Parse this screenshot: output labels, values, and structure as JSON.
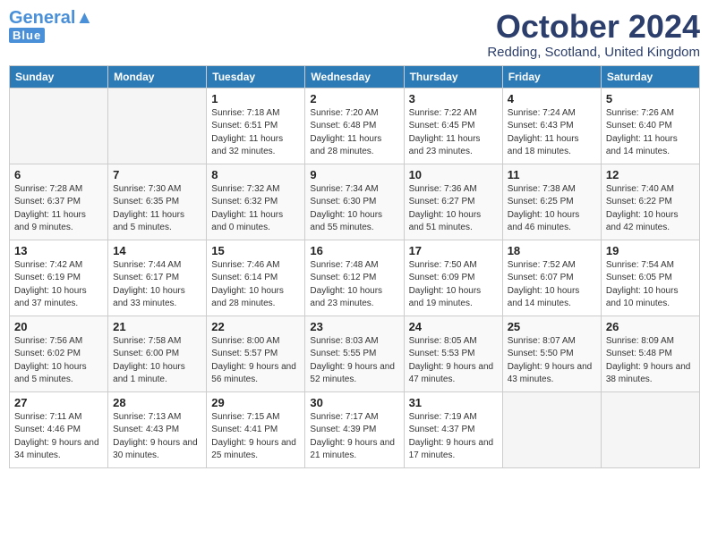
{
  "header": {
    "logo_general": "General",
    "logo_blue": "Blue",
    "title": "October 2024",
    "subtitle": "Redding, Scotland, United Kingdom"
  },
  "days_of_week": [
    "Sunday",
    "Monday",
    "Tuesday",
    "Wednesday",
    "Thursday",
    "Friday",
    "Saturday"
  ],
  "weeks": [
    [
      {
        "day": "",
        "sunrise": "",
        "sunset": "",
        "daylight": "",
        "empty": true
      },
      {
        "day": "",
        "sunrise": "",
        "sunset": "",
        "daylight": "",
        "empty": true
      },
      {
        "day": "1",
        "sunrise": "Sunrise: 7:18 AM",
        "sunset": "Sunset: 6:51 PM",
        "daylight": "Daylight: 11 hours and 32 minutes.",
        "empty": false
      },
      {
        "day": "2",
        "sunrise": "Sunrise: 7:20 AM",
        "sunset": "Sunset: 6:48 PM",
        "daylight": "Daylight: 11 hours and 28 minutes.",
        "empty": false
      },
      {
        "day": "3",
        "sunrise": "Sunrise: 7:22 AM",
        "sunset": "Sunset: 6:45 PM",
        "daylight": "Daylight: 11 hours and 23 minutes.",
        "empty": false
      },
      {
        "day": "4",
        "sunrise": "Sunrise: 7:24 AM",
        "sunset": "Sunset: 6:43 PM",
        "daylight": "Daylight: 11 hours and 18 minutes.",
        "empty": false
      },
      {
        "day": "5",
        "sunrise": "Sunrise: 7:26 AM",
        "sunset": "Sunset: 6:40 PM",
        "daylight": "Daylight: 11 hours and 14 minutes.",
        "empty": false
      }
    ],
    [
      {
        "day": "6",
        "sunrise": "Sunrise: 7:28 AM",
        "sunset": "Sunset: 6:37 PM",
        "daylight": "Daylight: 11 hours and 9 minutes.",
        "empty": false
      },
      {
        "day": "7",
        "sunrise": "Sunrise: 7:30 AM",
        "sunset": "Sunset: 6:35 PM",
        "daylight": "Daylight: 11 hours and 5 minutes.",
        "empty": false
      },
      {
        "day": "8",
        "sunrise": "Sunrise: 7:32 AM",
        "sunset": "Sunset: 6:32 PM",
        "daylight": "Daylight: 11 hours and 0 minutes.",
        "empty": false
      },
      {
        "day": "9",
        "sunrise": "Sunrise: 7:34 AM",
        "sunset": "Sunset: 6:30 PM",
        "daylight": "Daylight: 10 hours and 55 minutes.",
        "empty": false
      },
      {
        "day": "10",
        "sunrise": "Sunrise: 7:36 AM",
        "sunset": "Sunset: 6:27 PM",
        "daylight": "Daylight: 10 hours and 51 minutes.",
        "empty": false
      },
      {
        "day": "11",
        "sunrise": "Sunrise: 7:38 AM",
        "sunset": "Sunset: 6:25 PM",
        "daylight": "Daylight: 10 hours and 46 minutes.",
        "empty": false
      },
      {
        "day": "12",
        "sunrise": "Sunrise: 7:40 AM",
        "sunset": "Sunset: 6:22 PM",
        "daylight": "Daylight: 10 hours and 42 minutes.",
        "empty": false
      }
    ],
    [
      {
        "day": "13",
        "sunrise": "Sunrise: 7:42 AM",
        "sunset": "Sunset: 6:19 PM",
        "daylight": "Daylight: 10 hours and 37 minutes.",
        "empty": false
      },
      {
        "day": "14",
        "sunrise": "Sunrise: 7:44 AM",
        "sunset": "Sunset: 6:17 PM",
        "daylight": "Daylight: 10 hours and 33 minutes.",
        "empty": false
      },
      {
        "day": "15",
        "sunrise": "Sunrise: 7:46 AM",
        "sunset": "Sunset: 6:14 PM",
        "daylight": "Daylight: 10 hours and 28 minutes.",
        "empty": false
      },
      {
        "day": "16",
        "sunrise": "Sunrise: 7:48 AM",
        "sunset": "Sunset: 6:12 PM",
        "daylight": "Daylight: 10 hours and 23 minutes.",
        "empty": false
      },
      {
        "day": "17",
        "sunrise": "Sunrise: 7:50 AM",
        "sunset": "Sunset: 6:09 PM",
        "daylight": "Daylight: 10 hours and 19 minutes.",
        "empty": false
      },
      {
        "day": "18",
        "sunrise": "Sunrise: 7:52 AM",
        "sunset": "Sunset: 6:07 PM",
        "daylight": "Daylight: 10 hours and 14 minutes.",
        "empty": false
      },
      {
        "day": "19",
        "sunrise": "Sunrise: 7:54 AM",
        "sunset": "Sunset: 6:05 PM",
        "daylight": "Daylight: 10 hours and 10 minutes.",
        "empty": false
      }
    ],
    [
      {
        "day": "20",
        "sunrise": "Sunrise: 7:56 AM",
        "sunset": "Sunset: 6:02 PM",
        "daylight": "Daylight: 10 hours and 5 minutes.",
        "empty": false
      },
      {
        "day": "21",
        "sunrise": "Sunrise: 7:58 AM",
        "sunset": "Sunset: 6:00 PM",
        "daylight": "Daylight: 10 hours and 1 minute.",
        "empty": false
      },
      {
        "day": "22",
        "sunrise": "Sunrise: 8:00 AM",
        "sunset": "Sunset: 5:57 PM",
        "daylight": "Daylight: 9 hours and 56 minutes.",
        "empty": false
      },
      {
        "day": "23",
        "sunrise": "Sunrise: 8:03 AM",
        "sunset": "Sunset: 5:55 PM",
        "daylight": "Daylight: 9 hours and 52 minutes.",
        "empty": false
      },
      {
        "day": "24",
        "sunrise": "Sunrise: 8:05 AM",
        "sunset": "Sunset: 5:53 PM",
        "daylight": "Daylight: 9 hours and 47 minutes.",
        "empty": false
      },
      {
        "day": "25",
        "sunrise": "Sunrise: 8:07 AM",
        "sunset": "Sunset: 5:50 PM",
        "daylight": "Daylight: 9 hours and 43 minutes.",
        "empty": false
      },
      {
        "day": "26",
        "sunrise": "Sunrise: 8:09 AM",
        "sunset": "Sunset: 5:48 PM",
        "daylight": "Daylight: 9 hours and 38 minutes.",
        "empty": false
      }
    ],
    [
      {
        "day": "27",
        "sunrise": "Sunrise: 7:11 AM",
        "sunset": "Sunset: 4:46 PM",
        "daylight": "Daylight: 9 hours and 34 minutes.",
        "empty": false
      },
      {
        "day": "28",
        "sunrise": "Sunrise: 7:13 AM",
        "sunset": "Sunset: 4:43 PM",
        "daylight": "Daylight: 9 hours and 30 minutes.",
        "empty": false
      },
      {
        "day": "29",
        "sunrise": "Sunrise: 7:15 AM",
        "sunset": "Sunset: 4:41 PM",
        "daylight": "Daylight: 9 hours and 25 minutes.",
        "empty": false
      },
      {
        "day": "30",
        "sunrise": "Sunrise: 7:17 AM",
        "sunset": "Sunset: 4:39 PM",
        "daylight": "Daylight: 9 hours and 21 minutes.",
        "empty": false
      },
      {
        "day": "31",
        "sunrise": "Sunrise: 7:19 AM",
        "sunset": "Sunset: 4:37 PM",
        "daylight": "Daylight: 9 hours and 17 minutes.",
        "empty": false
      },
      {
        "day": "",
        "sunrise": "",
        "sunset": "",
        "daylight": "",
        "empty": true
      },
      {
        "day": "",
        "sunrise": "",
        "sunset": "",
        "daylight": "",
        "empty": true
      }
    ]
  ]
}
